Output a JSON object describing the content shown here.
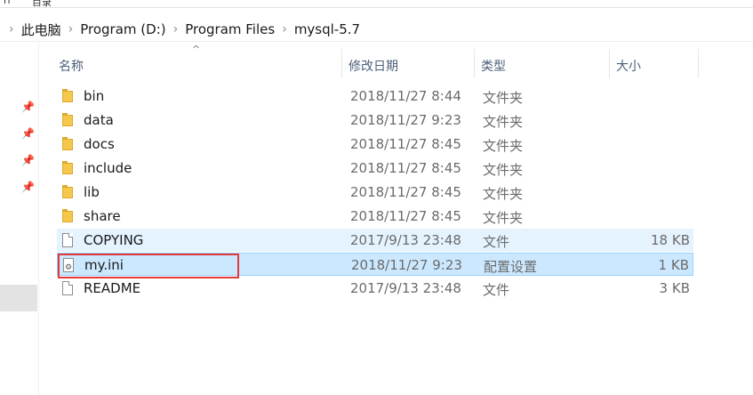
{
  "top_strip": {
    "left_text": "ri",
    "right_text": "目录"
  },
  "breadcrumb": {
    "items": [
      "此电脑",
      "Program (D:)",
      "Program Files",
      "mysql-5.7"
    ]
  },
  "columns": {
    "name": "名称",
    "date": "修改日期",
    "type": "类型",
    "size": "大小"
  },
  "files": [
    {
      "name": "bin",
      "date": "2018/11/27 8:44",
      "type": "文件夹",
      "size": "",
      "icon": "folder-icon"
    },
    {
      "name": "data",
      "date": "2018/11/27 9:23",
      "type": "文件夹",
      "size": "",
      "icon": "folder-icon"
    },
    {
      "name": "docs",
      "date": "2018/11/27 8:45",
      "type": "文件夹",
      "size": "",
      "icon": "folder-icon"
    },
    {
      "name": "include",
      "date": "2018/11/27 8:45",
      "type": "文件夹",
      "size": "",
      "icon": "folder-icon"
    },
    {
      "name": "lib",
      "date": "2018/11/27 8:45",
      "type": "文件夹",
      "size": "",
      "icon": "folder-icon"
    },
    {
      "name": "share",
      "date": "2018/11/27 8:45",
      "type": "文件夹",
      "size": "",
      "icon": "folder-icon"
    },
    {
      "name": "COPYING",
      "date": "2017/9/13 23:48",
      "type": "文件",
      "size": "18 KB",
      "icon": "file-icon"
    },
    {
      "name": "my.ini",
      "date": "2018/11/27 9:23",
      "type": "配置设置",
      "size": "1 KB",
      "icon": "settings-file-icon"
    },
    {
      "name": "README",
      "date": "2017/9/13 23:48",
      "type": "文件",
      "size": "3 KB",
      "icon": "file-icon"
    }
  ],
  "colors": {
    "hover_row": "#e5f3ff",
    "selected_row": "#cce8ff",
    "highlight_box": "#e03a3a"
  }
}
